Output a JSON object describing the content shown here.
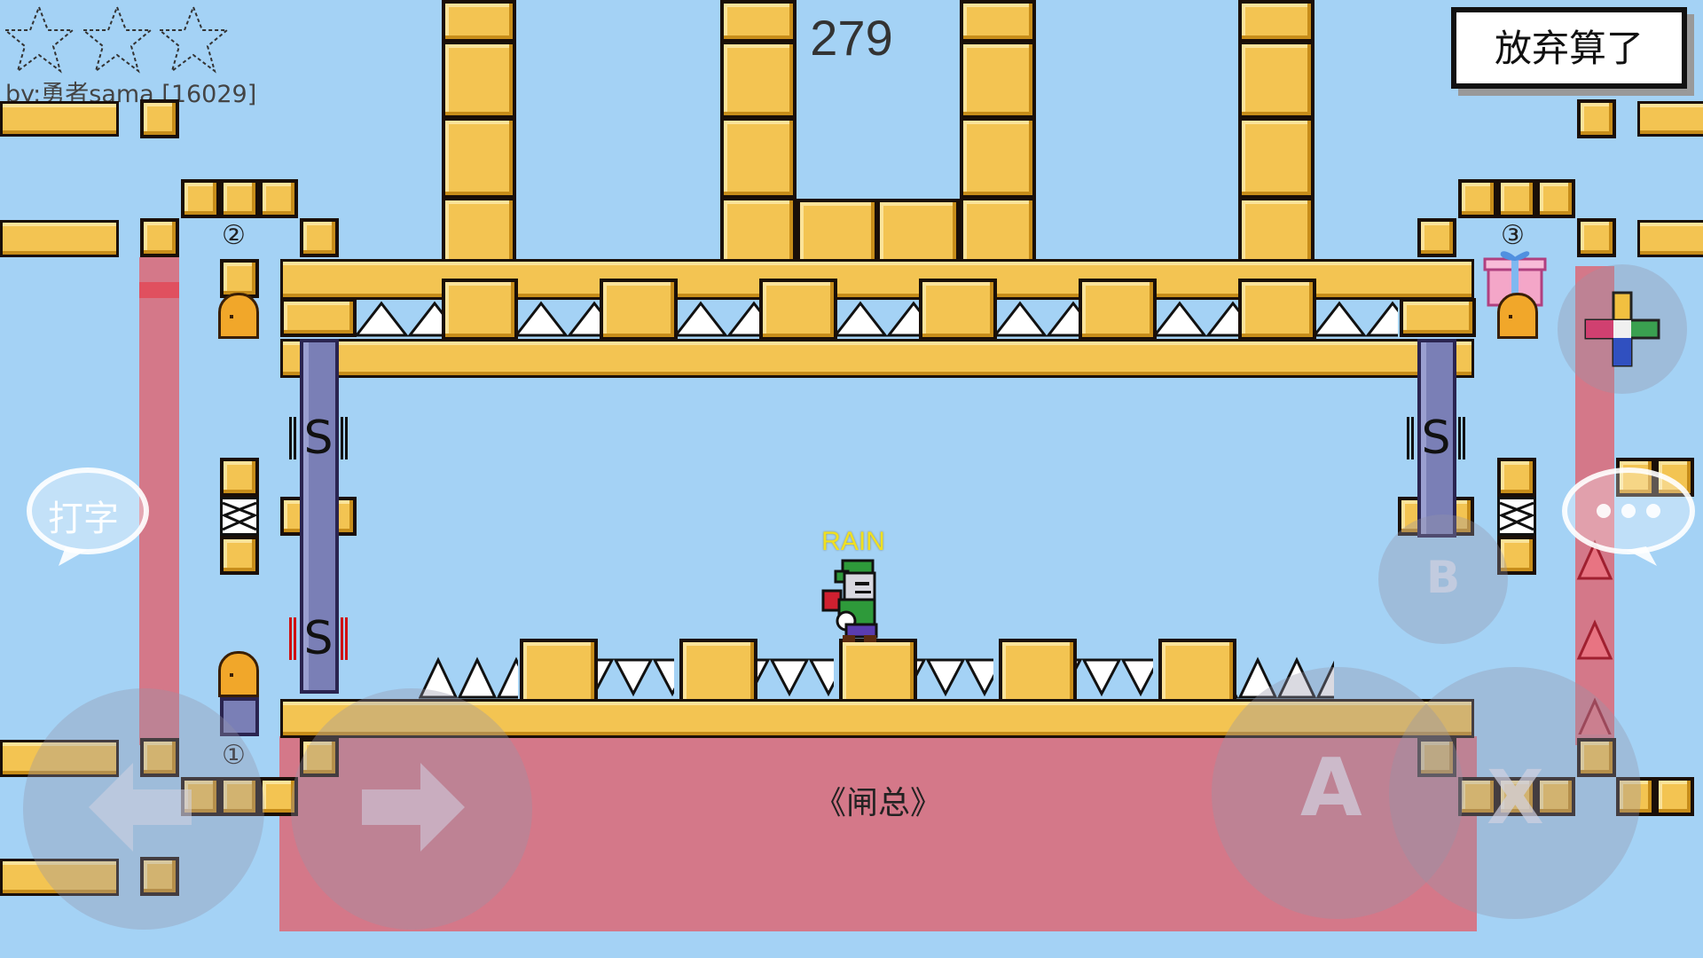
{
  "hud": {
    "author": "by:勇者sama [16029]",
    "timer": "279",
    "give_up_label": "放弃算了",
    "stars_total": 3,
    "stars_earned": 0
  },
  "level": {
    "player_name": "RAIN",
    "zone_label": "《闸总》",
    "switch_glyph": "S",
    "door_numbers": [
      "②",
      "③",
      "①"
    ]
  },
  "controls": {
    "type_label": "打字",
    "a_label": "A",
    "b_label": "B",
    "x_label": "X",
    "chat_icon": "speech-bubble-icon",
    "dpad_icon": "dpad-cross-icon",
    "left_icon": "arrow-left-icon",
    "right_icon": "arrow-right-icon"
  },
  "colors": {
    "sky": "#a4d2f5",
    "block": "#f3c452",
    "danger_zone": "#d8707f",
    "pillar": "#7a7fb6",
    "player_name": "#f0e020"
  }
}
